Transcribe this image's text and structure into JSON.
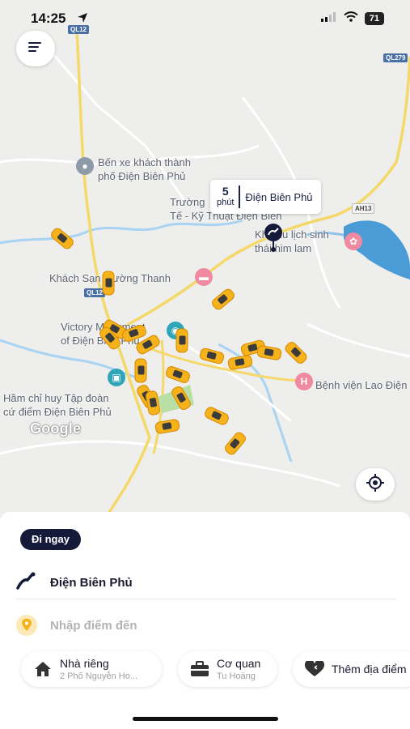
{
  "status": {
    "time": "14:25",
    "battery": "71"
  },
  "map": {
    "shields": {
      "ql12_top": "QL12",
      "ql279": "QL279",
      "ah13": "AH13",
      "ql12_mid": "QL12"
    },
    "labels": {
      "bus_station_line1": "Bến xe khách thành",
      "bus_station_line2": "phố Điện Biên Phủ",
      "school_line1": "Trường",
      "school_line2": "Tế - Kỹ Thuật Điện Biên",
      "tourism_line1": "Khu du lịch sinh",
      "tourism_line2": "thái him lam",
      "hotel": "Khách Sạn Mường Thanh",
      "victory_line1": "Victory Monument",
      "victory_line2": "of Điện Biên Phủ",
      "hospital": "Bệnh viện Lao Điện",
      "bunker_line1": "Hầm chỉ huy Tập đoàn",
      "bunker_line2": "cứ điểm Điện Biên Phủ"
    },
    "google": "Google",
    "eta": {
      "minutes": "5",
      "unit": "phút",
      "place": "Điện Biên Phủ"
    }
  },
  "sheet": {
    "now_label": "Đi ngay",
    "origin": "Điện Biên Phủ",
    "destination_placeholder": "Nhập điểm đến",
    "chips": [
      {
        "title": "Nhà riêng",
        "sub": "2 Phố Nguyễn Ho...",
        "icon": "home-icon"
      },
      {
        "title": "Cơ quan",
        "sub": "Tu Hoàng",
        "icon": "briefcase-icon"
      },
      {
        "title": "Thêm địa điểm",
        "sub": "",
        "icon": "heart-icon"
      }
    ]
  },
  "colors": {
    "accent_navy": "#161a3a",
    "taxi_yellow": "#f6b21a",
    "map_bg": "#eeeeec",
    "water": "#4a9bd6"
  }
}
